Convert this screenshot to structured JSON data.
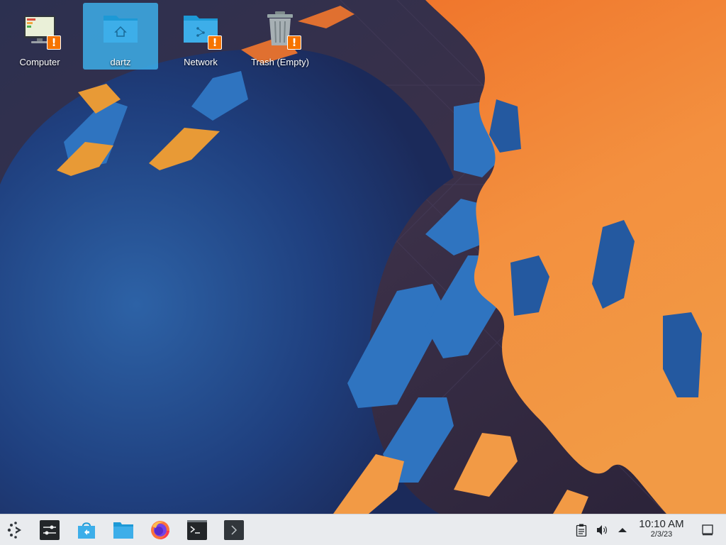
{
  "desktop": {
    "icons": [
      {
        "label": "Computer",
        "icon": "computer-icon",
        "selected": false,
        "badge": "!"
      },
      {
        "label": "dartz",
        "icon": "home-folder-icon",
        "selected": true
      },
      {
        "label": "Network",
        "icon": "network-folder-icon",
        "selected": false,
        "badge": "!"
      },
      {
        "label": "Trash (Empty)",
        "icon": "trash-icon",
        "selected": false,
        "badge": "!"
      }
    ],
    "selection_color": "#3daee9",
    "badge_color": "#f67400"
  },
  "taskbar": {
    "launchers": [
      {
        "name": "application-launcher",
        "icon": "kde-launcher-icon"
      },
      {
        "name": "system-settings",
        "icon": "settings-sliders-icon"
      },
      {
        "name": "discover",
        "icon": "software-center-icon"
      },
      {
        "name": "dolphin",
        "icon": "file-manager-icon"
      },
      {
        "name": "firefox",
        "icon": "firefox-icon"
      },
      {
        "name": "konsole",
        "icon": "terminal-icon"
      },
      {
        "name": "run-command",
        "icon": "run-command-icon"
      }
    ],
    "tray": {
      "icons": [
        "clipboard-icon",
        "volume-icon",
        "expand-tray-icon"
      ]
    },
    "clock": {
      "time": "10:10 AM",
      "date": "2/3/23"
    },
    "show_desktop_icon": "show-desktop-icon"
  }
}
